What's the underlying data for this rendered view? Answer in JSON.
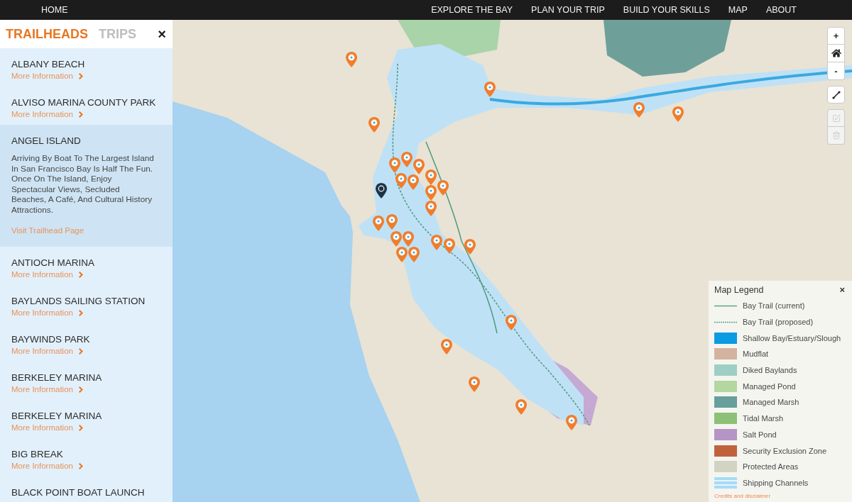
{
  "nav": {
    "home": "HOME",
    "items": [
      "EXPLORE THE BAY",
      "PLAN YOUR TRIP",
      "BUILD YOUR SKILLS",
      "MAP",
      "ABOUT"
    ]
  },
  "sidebar": {
    "tabs": [
      {
        "label": "TRAILHEADS",
        "selected": true
      },
      {
        "label": "TRIPS",
        "selected": false
      }
    ],
    "close": "×",
    "items": [
      {
        "name": "ALBANY BEACH",
        "expanded": false,
        "link": "More Information"
      },
      {
        "name": "ALVISO MARINA COUNTY PARK",
        "expanded": false,
        "link": "More Information"
      },
      {
        "name": "ANGEL ISLAND",
        "expanded": true,
        "description": "Arriving By Boat To The Largest Island In San Francisco Bay Is Half The Fun. Once On The Island, Enjoy Spectacular Views, Secluded Beaches, A Café, And Cultural History Attractions.",
        "link": "Visit Trailhead Page"
      },
      {
        "name": "ANTIOCH MARINA",
        "expanded": false,
        "link": "More Information"
      },
      {
        "name": "BAYLANDS SAILING STATION",
        "expanded": false,
        "link": "More Information"
      },
      {
        "name": "BAYWINDS PARK",
        "expanded": false,
        "link": "More Information"
      },
      {
        "name": "BERKELEY MARINA",
        "expanded": false,
        "link": "More Information"
      },
      {
        "name": "BERKELEY MARINA",
        "expanded": false,
        "link": "More Information"
      },
      {
        "name": "BIG BREAK",
        "expanded": false,
        "link": "More Information"
      },
      {
        "name": "BLACK POINT BOAT LAUNCH",
        "expanded": false
      }
    ]
  },
  "map": {
    "pins": [
      {
        "selected": false
      },
      {
        "selected": false
      },
      {
        "selected": false
      },
      {
        "selected": false
      },
      {
        "selected": false
      },
      {
        "selected": false
      },
      {
        "selected": false
      },
      {
        "selected": false
      },
      {
        "selected": false
      },
      {
        "selected": false
      },
      {
        "selected": false
      },
      {
        "selected": false
      },
      {
        "selected": false
      },
      {
        "selected": false
      },
      {
        "selected": true
      },
      {
        "selected": false
      },
      {
        "selected": false
      },
      {
        "selected": false
      },
      {
        "selected": false
      },
      {
        "selected": false
      },
      {
        "selected": false
      },
      {
        "selected": false
      },
      {
        "selected": false
      },
      {
        "selected": false
      },
      {
        "selected": false
      },
      {
        "selected": false
      },
      {
        "selected": false
      },
      {
        "selected": false
      },
      {
        "selected": false
      }
    ],
    "controls": [
      {
        "buttons": [
          {
            "kind": "zoom_in",
            "label": "+",
            "disabled": false
          },
          {
            "kind": "home",
            "disabled": false
          },
          {
            "kind": "zoom_out",
            "label": "-",
            "disabled": false
          }
        ]
      },
      {
        "buttons": [
          {
            "kind": "measure",
            "disabled": false
          }
        ]
      },
      {
        "buttons": [
          {
            "kind": "edit",
            "disabled": true
          },
          {
            "kind": "delete",
            "disabled": true
          }
        ]
      }
    ],
    "legend": {
      "title": "Map Legend",
      "close": "×",
      "items": [
        {
          "kind": "line",
          "label": "Bay Trail (current)",
          "color": "#5aa587"
        },
        {
          "kind": "dashed_line",
          "label": "Bay Trail (proposed)",
          "color": "#5aa587"
        },
        {
          "kind": "swatch",
          "label": "Shallow Bay/Estuary/Slough",
          "color": "#0a9be3"
        },
        {
          "kind": "swatch",
          "label": "Mudflat",
          "color": "#d3b2a0"
        },
        {
          "kind": "swatch",
          "label": "Diked Baylands",
          "color": "#9dcfc4"
        },
        {
          "kind": "swatch",
          "label": "Managed Pond",
          "color": "#b3d7a0"
        },
        {
          "kind": "swatch",
          "label": "Managed Marsh",
          "color": "#689e9b"
        },
        {
          "kind": "swatch",
          "label": "Tidal Marsh",
          "color": "#8cc177"
        },
        {
          "kind": "swatch",
          "label": "Salt Pond",
          "color": "#b594c6"
        },
        {
          "kind": "swatch",
          "label": "Security Exclusion Zone",
          "color": "#c0633d"
        },
        {
          "kind": "swatch",
          "label": "Protected Areas",
          "color": "#d3d3c3"
        },
        {
          "kind": "striped",
          "label": "Shipping Channels",
          "color": "#a8daf6"
        }
      ],
      "credits": "Credits and disclaimer"
    }
  }
}
